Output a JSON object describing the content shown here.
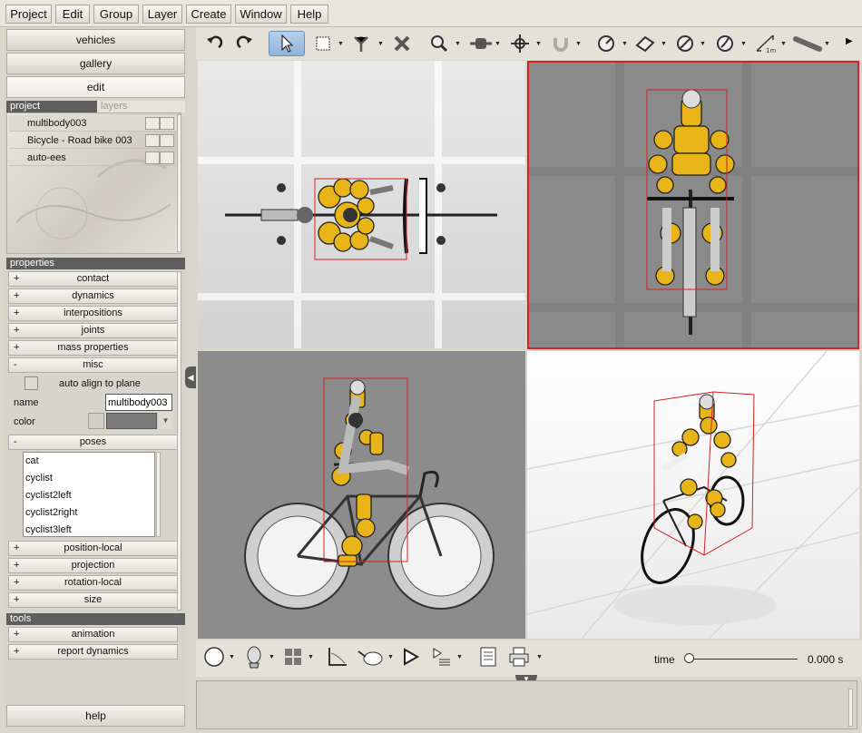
{
  "menu": [
    "Project",
    "Edit",
    "Group",
    "Layer",
    "Create",
    "Window",
    "Help"
  ],
  "nav": {
    "vehicles": "vehicles",
    "gallery": "gallery",
    "edit": "edit",
    "help": "help"
  },
  "project_panel": {
    "tab_project": "project",
    "tab_layers": "layers",
    "items": [
      "multibody003",
      "Bicycle - Road bike 003",
      "auto-ees"
    ]
  },
  "properties": {
    "header": "properties",
    "groups_top": [
      {
        "sign": "+",
        "label": "contact"
      },
      {
        "sign": "+",
        "label": "dynamics"
      },
      {
        "sign": "+",
        "label": "interpositions"
      },
      {
        "sign": "+",
        "label": "joints"
      },
      {
        "sign": "+",
        "label": "mass properties"
      },
      {
        "sign": "-",
        "label": "misc"
      }
    ],
    "misc": {
      "auto_align_label": "auto align to plane",
      "name_label": "name",
      "name_value": "multibody003",
      "color_label": "color"
    },
    "poses_group": {
      "sign": "-",
      "label": "poses"
    },
    "poses": [
      "cat",
      "cyclist",
      "cyclist2left",
      "cyclist2right",
      "cyclist3left"
    ],
    "groups_bottom": [
      {
        "sign": "+",
        "label": "position-local"
      },
      {
        "sign": "+",
        "label": "projection"
      },
      {
        "sign": "+",
        "label": "rotation-local"
      },
      {
        "sign": "+",
        "label": "size"
      }
    ]
  },
  "tools": {
    "header": "tools",
    "groups": [
      {
        "sign": "+",
        "label": "animation"
      },
      {
        "sign": "+",
        "label": "report dynamics"
      }
    ]
  },
  "toolbar": {
    "icons": [
      "undo-icon",
      "redo-icon",
      "select-arrow-icon",
      "select-box-icon",
      "joint-icon",
      "delete-icon",
      "zoom-icon",
      "connector-icon",
      "move-icon",
      "magnet-icon",
      "angle-tool-icon",
      "ruler-block-icon",
      "angle-tool-icon-2",
      "angle-tool-icon-3",
      "measure-distance-icon",
      "tube-icon"
    ],
    "measure_label": "1m"
  },
  "timeline": {
    "label": "time",
    "value": "0.000 s",
    "position": 0.0
  },
  "colors": {
    "selection": "#d82020",
    "accent_yellow": "#e8b418",
    "viewport_gray": "#8a8a8a"
  }
}
